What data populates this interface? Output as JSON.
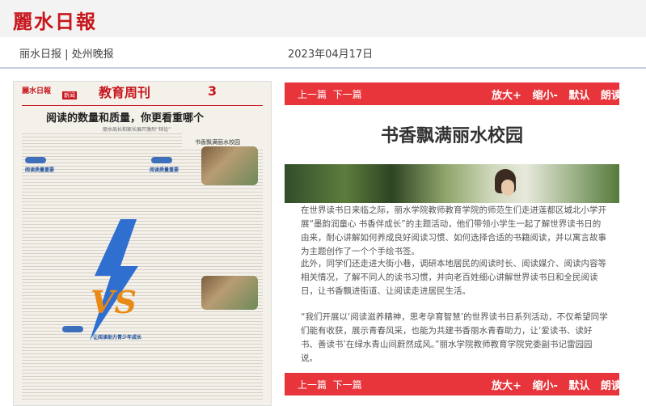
{
  "header": {
    "logo": "麗水日報",
    "publications": "丽水日报 | 处州晚报",
    "date": "2023年04月17日"
  },
  "thumbnail": {
    "logo": "麗水日報",
    "edition": "新闻",
    "section": "教育周刊",
    "page_number": "3",
    "headline": "阅读的数量和质量，你更看重哪个",
    "subhead": "丽水局长和家长展开激烈“辩论”",
    "side_title": "书香飘满丽水校园",
    "vs": "VS",
    "tag1": "阅读质量重要",
    "tag2": "阅读质量重要",
    "tag3": "让阅读助力青少年成长"
  },
  "nav": {
    "prev": "上一篇",
    "next": "下一篇",
    "zoom_in": "放大+",
    "zoom_out": "缩小-",
    "default": "默认",
    "read": "朗读"
  },
  "article": {
    "title": "书香飘满丽水校园",
    "paragraphs": [
      "在世界读书日来临之际，丽水学院教师教育学院的师范生们走进莲都区城北小学开展“墨韵润童心 书香伴成长”的主题活动，他们带领小学生一起了解世界读书日的由来，耐心讲解如何养成良好阅读习惯、如何选择合适的书籍阅读，并以寓言故事为主题创作了一个个手绘书签。",
      "此外，同学们还走进大街小巷，调研本地居民的阅读时长、阅读媒介、阅读内容等相关情况，了解不同人的读书习惯，并向老百姓细心讲解世界读书日和全民阅读日，让书香飘进街道、让阅读走进居民生活。",
      "“我们开展以‘阅读滋养精神，思考孕育智慧’的世界读书日系列活动，不仅希望同学们能有收获，展示青春风采，也能为共建书香丽水青春助力，让‘爱读书、读好书、善读书’在绿水青山间蔚然成风。”丽水学院教师教育学院党委副书记雷园园说。"
    ]
  },
  "colors": {
    "brand_red": "#c8161d",
    "bar_red": "#e8353b",
    "accent_blue": "#3d6fbb",
    "vs_orange": "#e98a17"
  }
}
